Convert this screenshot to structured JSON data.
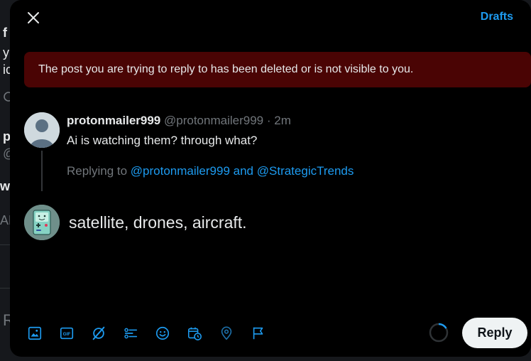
{
  "background": {
    "fragments": [
      "f",
      "y",
      "ic",
      "p",
      "@",
      "wa",
      "AM",
      "R"
    ]
  },
  "header": {
    "close_icon": "close-icon",
    "drafts_label": "Drafts"
  },
  "alert": {
    "message": "The post you are trying to reply to has been deleted or is not visible to you.",
    "color": "#4a0404"
  },
  "original_post": {
    "display_name": "protonmailer999",
    "handle": "@protonmailer999",
    "separator": "·",
    "time": "2m",
    "text": "Ai is watching them? through what?",
    "replying_prefix": "Replying to",
    "mention_1": "@protonmailer999",
    "mention_join": "and",
    "mention_2": "@StrategicTrends"
  },
  "compose": {
    "text": "satellite, drones, aircraft."
  },
  "toolbar": {
    "icons": [
      "image-icon",
      "gif-icon",
      "grok-icon",
      "poll-icon",
      "emoji-icon",
      "schedule-icon",
      "location-icon",
      "flag-icon"
    ],
    "accent": "#1d9bf0"
  },
  "reply_button": {
    "label": "Reply"
  }
}
